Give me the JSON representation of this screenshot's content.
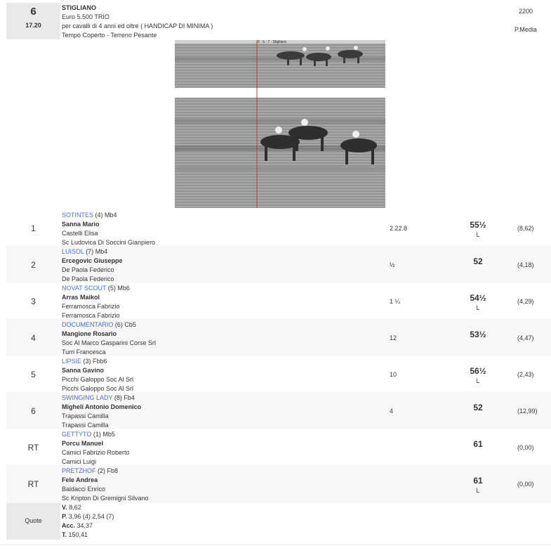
{
  "race": {
    "number": "6",
    "time": "17.20",
    "title": "STIGLIANO",
    "prize": "Euro 5.500 TRIO",
    "conditions": "per cavalli di 4 anni ed oltre ( HANDICAP DI MINIMA )",
    "weather": "Tempo Coperto - Terreno Pesante",
    "distance": "2200",
    "pmedia": "P.Media",
    "photo_caption": "6 · 6 · 7 · Stigliano"
  },
  "results": [
    {
      "pos": "1",
      "horse": "SOTINTES",
      "extra": " (4) Mb4",
      "jockey": "Sanna Mario",
      "trainer": "Castelli Elisa",
      "owner": "Sc Ludovica Di Soccini Gianpiero",
      "dist": "2.22.8",
      "weight": "55½",
      "L": "L",
      "odds": "(8,62)"
    },
    {
      "pos": "2",
      "horse": "LUISOL",
      "extra": " (7) Mb4",
      "jockey": "Ercegovic Giuseppe",
      "trainer": "De Paola Federico",
      "owner": "De Paola Federico",
      "dist": "½",
      "weight": "52",
      "L": "",
      "odds": "(4,18)"
    },
    {
      "pos": "3",
      "horse": "NOVAT SCOUT",
      "extra": " (5) Mb6",
      "jockey": "Arras Maikol",
      "trainer": "Ferramosca Fabrizio",
      "owner": "Ferramosca Fabrizio",
      "dist": "1 ¼",
      "weight": "54½",
      "L": "L",
      "odds": "(4,29)"
    },
    {
      "pos": "4",
      "horse": "DOCUMENTARIO",
      "extra": " (6) Cb5",
      "jockey": "Mangione Rosario",
      "trainer": "Soc Al Marco Gasparini Corse Srl",
      "owner": "Turri Francesca",
      "dist": "12",
      "weight": "53½",
      "L": "",
      "odds": "(4,47)"
    },
    {
      "pos": "5",
      "horse": "LIPSIE",
      "extra": " (3) Fbb6",
      "jockey": "Sanna Gavino",
      "trainer": "Picchi Galoppo Soc Al Srl",
      "owner": "Picchi Galoppo Soc Al Srl",
      "dist": "10",
      "weight": "56½",
      "L": "L",
      "odds": "(2,43)"
    },
    {
      "pos": "6",
      "horse": "SWINGING LADY",
      "extra": " (8) Fb4",
      "jockey": "Migheli Antonio Domenico",
      "trainer": "Trapassi Camilla",
      "owner": "Trapassi Camilla",
      "dist": "4",
      "weight": "52",
      "L": "",
      "odds": "(12,99)"
    },
    {
      "pos": "RT",
      "horse": "GETTYTO",
      "extra": " (1) Mb5",
      "jockey": "Porcu Manuel",
      "trainer": "Camici Fabrizio Roberto",
      "owner": "Camici Luigi",
      "dist": "",
      "weight": "61",
      "L": "",
      "odds": "(0,00)"
    },
    {
      "pos": "RT",
      "horse": "PRETZHOF",
      "extra": " (2) Fb8",
      "jockey": "Fele Andrea",
      "trainer": "Baldacci Enrico",
      "owner": "Sc Kripton Di Gremigni Silvano",
      "dist": "",
      "weight": "61",
      "L": "L",
      "odds": "(0,00)"
    }
  ],
  "quote": {
    "label": "Quote",
    "lines": [
      {
        "k": "V.",
        "v": " 8,62"
      },
      {
        "k": "P.",
        "v": " 3,96 (4)  2,54 (7)"
      },
      {
        "k": "Acc.",
        "v": " 34,37"
      },
      {
        "k": "T.",
        "v": " 150,41"
      }
    ]
  }
}
